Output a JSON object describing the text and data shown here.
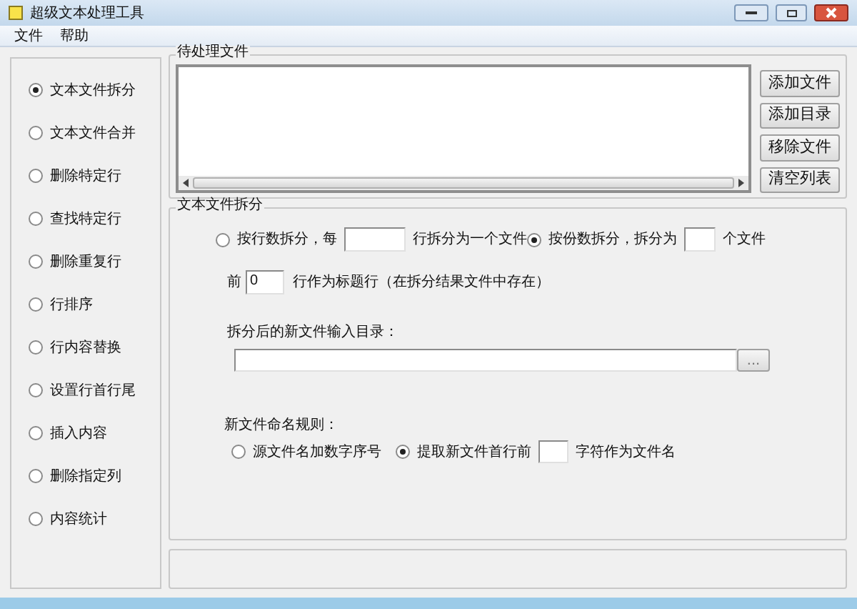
{
  "window": {
    "title": "超级文本处理工具"
  },
  "menu": [
    "文件",
    "帮助"
  ],
  "functions": [
    {
      "label": "文本文件拆分",
      "selected": true
    },
    {
      "label": "文本文件合并",
      "selected": false
    },
    {
      "label": "删除特定行",
      "selected": false
    },
    {
      "label": "查找特定行",
      "selected": false
    },
    {
      "label": "删除重复行",
      "selected": false
    },
    {
      "label": "行排序",
      "selected": false
    },
    {
      "label": "行内容替换",
      "selected": false
    },
    {
      "label": "设置行首行尾",
      "selected": false
    },
    {
      "label": "插入内容",
      "selected": false
    },
    {
      "label": "删除指定列",
      "selected": false
    },
    {
      "label": "内容统计",
      "selected": false
    }
  ],
  "file_list": {
    "title": "待处理文件",
    "buttons": [
      "添加文件",
      "添加目录",
      "移除文件",
      "清空列表"
    ]
  },
  "split": {
    "title": "文本文件拆分",
    "modes": [
      {
        "label": "按行数拆分，每",
        "suffix": "行拆分为一个文件",
        "selected": false
      },
      {
        "label": "按份数拆分，拆分为",
        "suffix": "个文件",
        "selected": true
      }
    ],
    "header": {
      "prefix": "前",
      "value": "0",
      "suffix": "行作为标题行（在拆分结果文件中存在）"
    },
    "output_dir": {
      "label": "拆分后的新文件输入目录：",
      "browse": "..."
    },
    "naming": {
      "title": "新文件命名规则：",
      "options": [
        {
          "label": "源文件名加数字序号",
          "selected": false
        },
        {
          "label": "提取新文件首行前",
          "suffix": "字符作为文件名",
          "selected": true
        }
      ]
    }
  }
}
